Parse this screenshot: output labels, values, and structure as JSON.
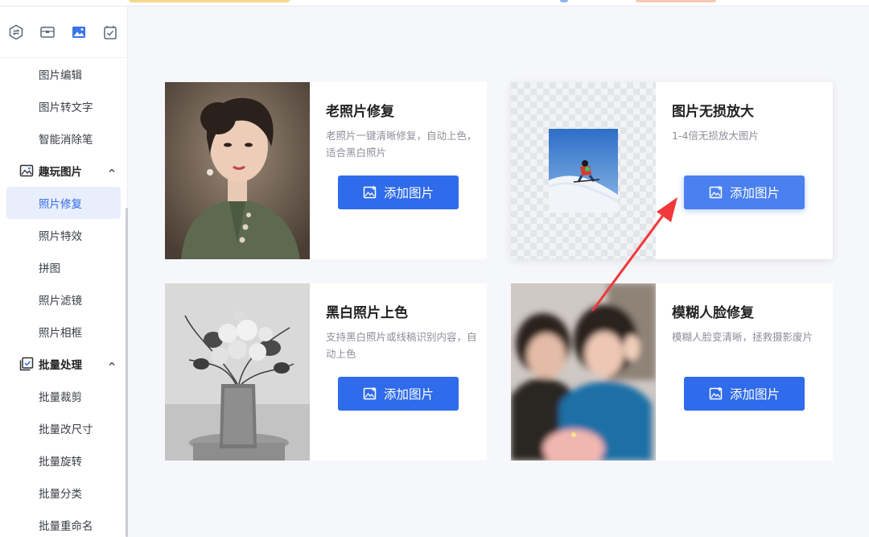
{
  "sidebar": {
    "top_icons": [
      "convert-icon",
      "compress-icon",
      "image-icon",
      "check-icon"
    ],
    "items_top": [
      {
        "label": "图片编辑"
      },
      {
        "label": "图片转文字"
      },
      {
        "label": "智能消除笔"
      }
    ],
    "group1": {
      "label": "趣玩图片",
      "icon": "image-play-icon"
    },
    "group1_items": [
      {
        "label": "照片修复",
        "active": true
      },
      {
        "label": "照片特效"
      },
      {
        "label": "拼图"
      },
      {
        "label": "照片滤镜"
      },
      {
        "label": "照片相框"
      }
    ],
    "group2": {
      "label": "批量处理",
      "icon": "batch-icon"
    },
    "group2_items": [
      {
        "label": "批量裁剪"
      },
      {
        "label": "批量改尺寸"
      },
      {
        "label": "批量旋转"
      },
      {
        "label": "批量分类"
      },
      {
        "label": "批量重命名"
      }
    ]
  },
  "cards": [
    {
      "title": "老照片修复",
      "desc": "老照片一键清晰修复，自动上色，适合黑白照片",
      "button": "添加图片",
      "image": "vintage-portrait-woman"
    },
    {
      "title": "图片无损放大",
      "desc": "1-4倍无损放大图片",
      "button": "添加图片",
      "image": "skier-on-snow"
    },
    {
      "title": "黑白照片上色",
      "desc": "支持黑白照片或线稿识别内容，自动上色",
      "button": "添加图片",
      "image": "bw-flowers-vase"
    },
    {
      "title": "模糊人脸修复",
      "desc": "模糊人脸变清晰，拯救摄影废片",
      "button": "添加图片",
      "image": "blurry-couple-selfie"
    }
  ],
  "colors": {
    "accent": "#2f6bea",
    "annotation_arrow": "#f0383a",
    "active_bg": "#e9eefc"
  }
}
